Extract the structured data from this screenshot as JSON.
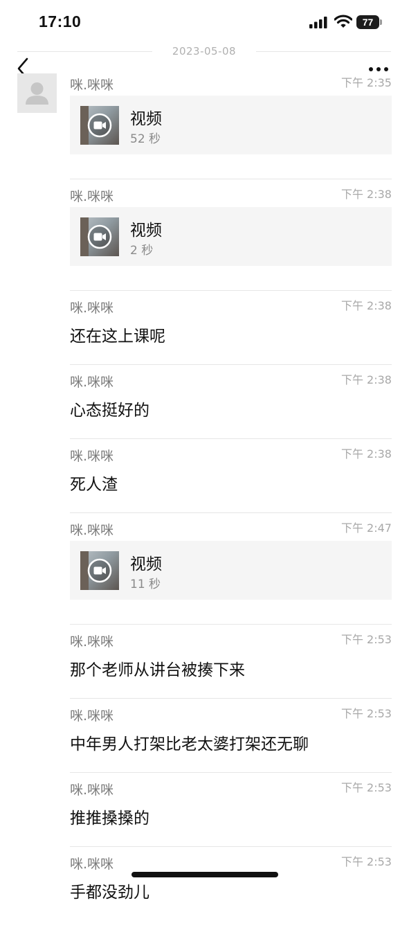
{
  "status_bar": {
    "time": "17:10",
    "battery": "77"
  },
  "header": {
    "date": "2023-05-08"
  },
  "icons": {
    "back": "chevron-left-icon",
    "more": "ellipsis-icon",
    "avatar": "default-person-icon",
    "video": "video-camera-icon"
  },
  "messages": [
    {
      "type": "video",
      "sender": "咪.咪咪",
      "time": "下午 2:35",
      "title": "视频",
      "duration": "52 秒"
    },
    {
      "type": "video",
      "sender": "咪.咪咪",
      "time": "下午 2:38",
      "title": "视频",
      "duration": "2 秒"
    },
    {
      "type": "text",
      "sender": "咪.咪咪",
      "time": "下午 2:38",
      "text": "还在这上课呢"
    },
    {
      "type": "text",
      "sender": "咪.咪咪",
      "time": "下午 2:38",
      "text": "心态挺好的"
    },
    {
      "type": "text",
      "sender": "咪.咪咪",
      "time": "下午 2:38",
      "text": "死人渣"
    },
    {
      "type": "video",
      "sender": "咪.咪咪",
      "time": "下午 2:47",
      "title": "视频",
      "duration": "11 秒"
    },
    {
      "type": "text",
      "sender": "咪.咪咪",
      "time": "下午 2:53",
      "text": "那个老师从讲台被揍下来"
    },
    {
      "type": "text",
      "sender": "咪.咪咪",
      "time": "下午 2:53",
      "text": "中年男人打架比老太婆打架还无聊"
    },
    {
      "type": "text",
      "sender": "咪.咪咪",
      "time": "下午 2:53",
      "text": "推推搡搡的"
    },
    {
      "type": "text",
      "sender": "咪.咪咪",
      "time": "下午 2:53",
      "text": "手都没劲儿"
    }
  ]
}
